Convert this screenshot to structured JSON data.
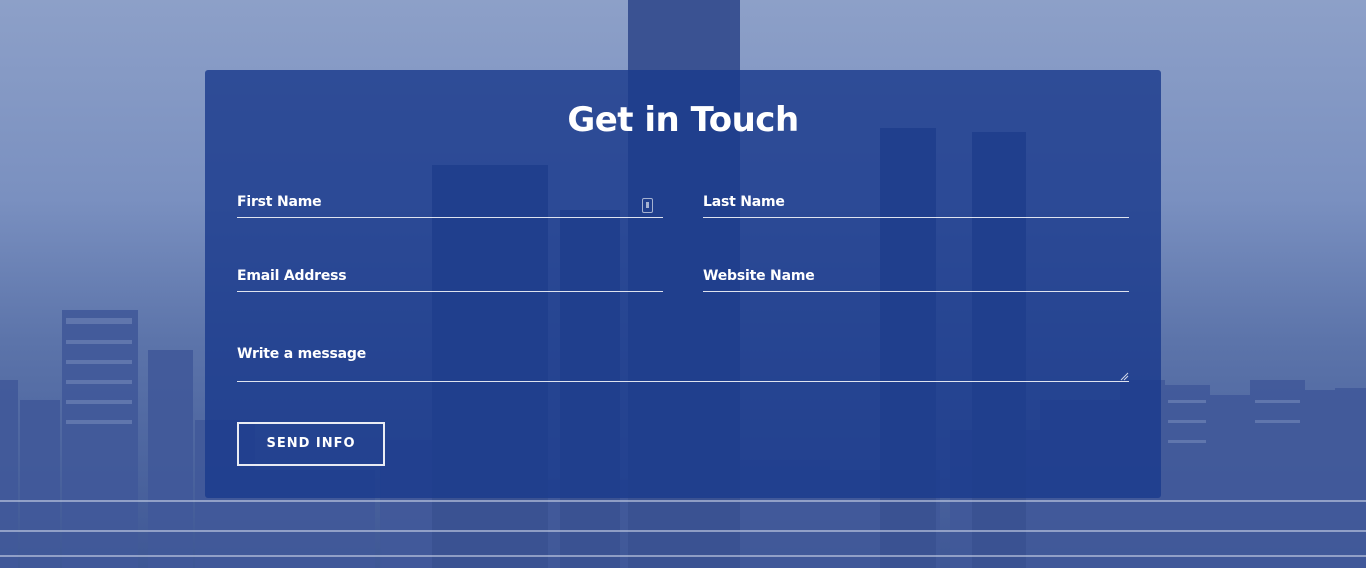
{
  "page": {
    "title": "Get in Touch"
  },
  "form": {
    "first_name_label": "First Name",
    "last_name_label": "Last Name",
    "email_label": "Email Address",
    "website_label": "Website Name",
    "message_label": "Write a message",
    "submit_label": "SEND INFO"
  },
  "colors": {
    "card_background": "#1b3b8c",
    "text": "#ffffff"
  }
}
